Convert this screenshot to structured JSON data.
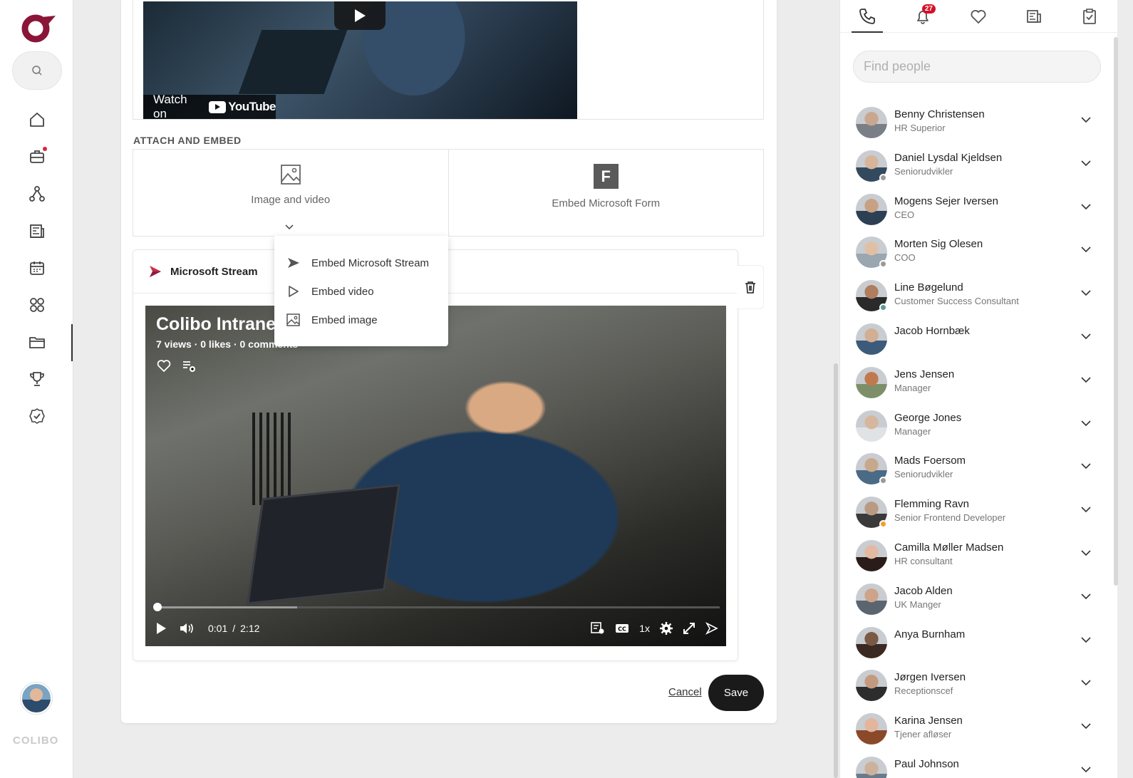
{
  "nav": {
    "brand": "COLIBO",
    "items": [
      "home-icon",
      "briefcase-icon",
      "network-icon",
      "news-icon",
      "calendar-icon",
      "apps-icon",
      "folder-icon",
      "trophy-icon",
      "badge-check-icon"
    ]
  },
  "youtube": {
    "watch_on": "Watch on",
    "brand": "YouTube"
  },
  "attach": {
    "section_title": "ATTACH AND EMBED",
    "image_video": "Image and video",
    "ms_form": "Embed Microsoft Form",
    "form_letter": "F"
  },
  "dropdown": {
    "items": [
      "Embed Microsoft Stream",
      "Embed video",
      "Embed image"
    ]
  },
  "stream": {
    "header": "Microsoft Stream",
    "video_title": "Colibo Intrane",
    "stats": "7 views · 0 likes · 0 comments",
    "time_current": "0:01",
    "time_separator": "/",
    "time_total": "2:12",
    "speed": "1x",
    "progress": 0.01
  },
  "actions": {
    "cancel": "Cancel",
    "save": "Save"
  },
  "right_panel": {
    "notification_count": "27",
    "search_placeholder": "Find people",
    "people": [
      {
        "name": "Benny Christensen",
        "title": "HR Superior",
        "status": ""
      },
      {
        "name": "Daniel Lysdal Kjeldsen",
        "title": "Seniorudvikler",
        "status": "#9a9a9a"
      },
      {
        "name": "Mogens Sejer Iversen",
        "title": "CEO",
        "status": ""
      },
      {
        "name": "Morten Sig Olesen",
        "title": "COO",
        "status": "#9a9a9a"
      },
      {
        "name": "Line Bøgelund",
        "title": "Customer Success Consultant",
        "status": "#5a9a9a"
      },
      {
        "name": "Jacob Hornbæk",
        "title": "",
        "status": ""
      },
      {
        "name": "Jens Jensen",
        "title": "Manager",
        "status": ""
      },
      {
        "name": "George Jones",
        "title": "Manager",
        "status": ""
      },
      {
        "name": "Mads Foersom",
        "title": "Seniorudvikler",
        "status": "#9a9a9a"
      },
      {
        "name": "Flemming Ravn",
        "title": "Senior Frontend Developer",
        "status": "#f0a030"
      },
      {
        "name": "Camilla Møller Madsen",
        "title": "HR consultant",
        "status": ""
      },
      {
        "name": "Jacob Alden",
        "title": "UK Manger",
        "status": ""
      },
      {
        "name": "Anya Burnham",
        "title": "",
        "status": ""
      },
      {
        "name": "Jørgen Iversen",
        "title": "Receptionscef",
        "status": ""
      },
      {
        "name": "Karina Jensen",
        "title": "Tjener afløser",
        "status": ""
      },
      {
        "name": "Paul Johnson",
        "title": "",
        "status": ""
      }
    ]
  },
  "colors": {
    "brand": "#8a1538",
    "badge": "#d4102a",
    "save_bg": "#1a1a1a"
  }
}
